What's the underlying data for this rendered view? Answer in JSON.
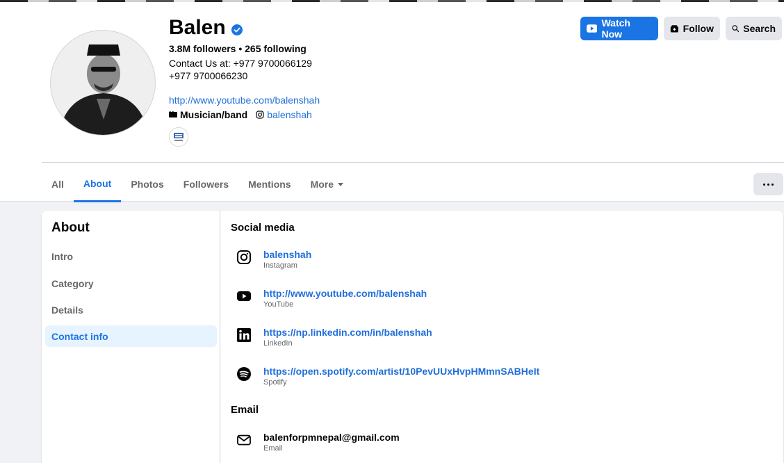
{
  "profile": {
    "name": "Balen",
    "stats": "3.8M followers • 265 following",
    "bio_line1": "Contact Us at: +977 9700066129",
    "bio_line2": "+977 9700066230",
    "website": "http://www.youtube.com/balenshah",
    "category": "Musician/band",
    "instagram": "balenshah"
  },
  "actions": {
    "watch_label": "Watch Now",
    "follow_label": "Follow",
    "search_label": "Search"
  },
  "tabs": [
    {
      "label": "All"
    },
    {
      "label": "About"
    },
    {
      "label": "Photos"
    },
    {
      "label": "Followers"
    },
    {
      "label": "Mentions"
    },
    {
      "label": "More"
    }
  ],
  "about_nav": {
    "heading": "About",
    "items": [
      {
        "label": "Intro"
      },
      {
        "label": "Category"
      },
      {
        "label": "Details"
      },
      {
        "label": "Contact info"
      }
    ]
  },
  "social_media": {
    "title": "Social media",
    "entries": [
      {
        "value": "balenshah",
        "type": "Instagram",
        "icon": "instagram-icon"
      },
      {
        "value": "http://www.youtube.com/balenshah",
        "type": "YouTube",
        "icon": "youtube-icon"
      },
      {
        "value": "https://np.linkedin.com/in/balenshah",
        "type": "LinkedIn",
        "icon": "linkedin-icon"
      },
      {
        "value": "https://open.spotify.com/artist/10PevUUxHvpHMmnSABHeIt",
        "type": "Spotify",
        "icon": "spotify-icon"
      }
    ]
  },
  "email": {
    "title": "Email",
    "value": "balenforpmnepal@gmail.com",
    "type": "Email"
  },
  "colors": {
    "accent": "#1b74e4",
    "link": "#216fdb",
    "active_nav_bg": "#e7f3ff"
  }
}
